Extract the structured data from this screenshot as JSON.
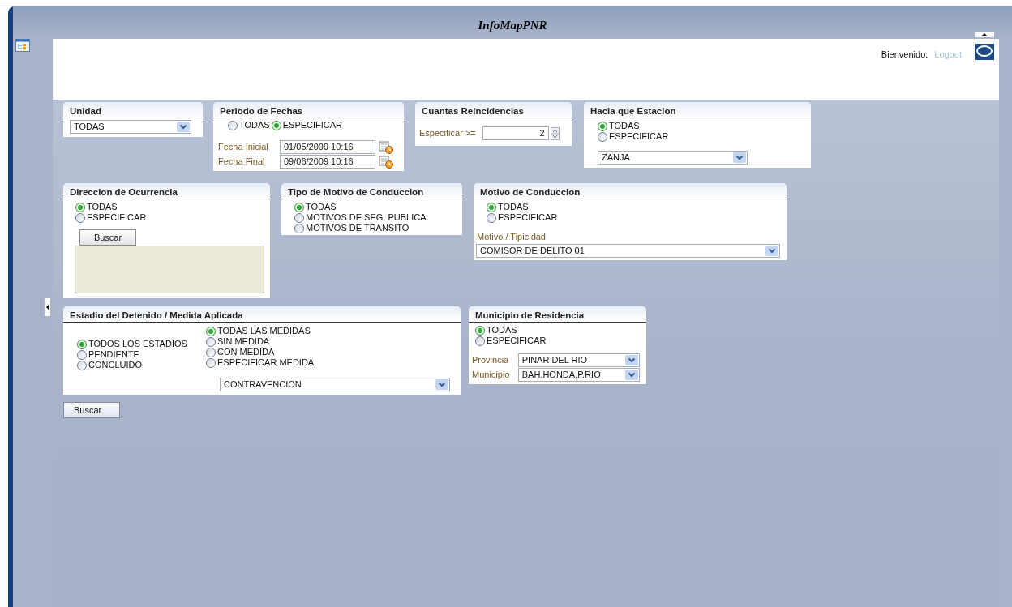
{
  "app": {
    "title": "InfoMapPNR"
  },
  "header": {
    "welcome": "Bienvenido:",
    "logout_link": "Logout"
  },
  "panels": [
    {
      "kind": "unidad",
      "title": "Unidad",
      "select": "TODAS"
    },
    {
      "kind": "periodo",
      "title": "Periodo de Fechas",
      "options": [
        {
          "label": "TODAS",
          "selected": false
        },
        {
          "label": "ESPECIFICAR",
          "selected": true
        }
      ],
      "dates": [
        {
          "label": "Fecha Inicial",
          "value": "01/05/2009 10:16"
        },
        {
          "label": "Fecha Final",
          "value": "09/06/2009 10:16"
        }
      ]
    },
    {
      "kind": "reincidencias",
      "title": "Cuantas Reincidencias",
      "label": "Especificar >=",
      "value": "2"
    },
    {
      "kind": "estacion",
      "title": "Hacia que Estacion",
      "options": [
        {
          "label": "TODAS",
          "selected": true
        },
        {
          "label": "ESPECIFICAR",
          "selected": false
        }
      ],
      "select": "ZANJA"
    },
    {
      "kind": "direccion",
      "title": "Direccion de Ocurrencia",
      "options": [
        {
          "label": "TODAS",
          "selected": true
        },
        {
          "label": "ESPECIFICAR",
          "selected": false
        }
      ],
      "button": "Buscar"
    },
    {
      "kind": "tipo",
      "title": "Tipo de Motivo de Conduccion",
      "options": [
        {
          "label": "TODAS",
          "selected": true
        },
        {
          "label": "MOTIVOS DE SEG. PUBLICA",
          "selected": false
        },
        {
          "label": "MOTIVOS DE TRANSITO",
          "selected": false
        }
      ]
    },
    {
      "kind": "motivo",
      "title": "Motivo de Conduccion",
      "options": [
        {
          "label": "TODAS",
          "selected": true
        },
        {
          "label": "ESPECIFICAR",
          "selected": false
        }
      ],
      "field_label": "Motivo / Tipicidad",
      "select": "COMISOR DE DELITO 01"
    },
    {
      "kind": "estadio",
      "title": "Estadio del Detenido / Medida Aplicada",
      "estados": [
        {
          "label": "TODOS LOS ESTADIOS",
          "selected": true
        },
        {
          "label": "PENDIENTE",
          "selected": false
        },
        {
          "label": "CONCLUIDO",
          "selected": false
        }
      ],
      "medidas": [
        {
          "label": "TODAS LAS MEDIDAS",
          "selected": true
        },
        {
          "label": "SIN MEDIDA",
          "selected": false
        },
        {
          "label": "CON MEDIDA",
          "selected": false
        },
        {
          "label": "ESPECIFICAR MEDIDA",
          "selected": false
        }
      ],
      "select": "CONTRAVENCION"
    },
    {
      "kind": "municipio",
      "title": "Municipio de Residencia",
      "options": [
        {
          "label": "TODAS",
          "selected": true
        },
        {
          "label": "ESPECIFICAR",
          "selected": false
        }
      ],
      "fields": [
        {
          "label": "Provincia",
          "value": "PINAR DEL RIO"
        },
        {
          "label": "Municipio",
          "value": "BAH.HONDA,P.RIO"
        }
      ]
    }
  ],
  "search_button": "Buscar"
}
